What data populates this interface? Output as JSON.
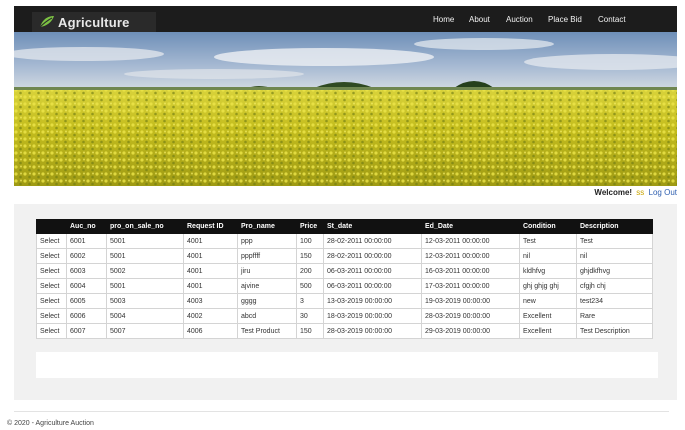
{
  "brand": {
    "name": "Agriculture"
  },
  "nav": {
    "items": [
      "Home",
      "About",
      "Auction",
      "Place Bid",
      "Contact"
    ]
  },
  "user": {
    "welcome": "Welcome!",
    "name": "ss",
    "logout": "Log Out"
  },
  "table": {
    "headers": [
      "",
      "Auc_no",
      "pro_on_sale_no",
      "Request ID",
      "Pro_name",
      "Price",
      "St_date",
      "Ed_Date",
      "Condition",
      "Description"
    ],
    "select_label": "Select",
    "rows": [
      [
        "6001",
        "5001",
        "4001",
        "ppp",
        "100",
        "28-02-2011 00:00:00",
        "12-03-2011 00:00:00",
        "Test",
        "Test"
      ],
      [
        "6002",
        "5001",
        "4001",
        "pppffff",
        "150",
        "28-02-2011 00:00:00",
        "12-03-2011 00:00:00",
        "nil",
        "nil"
      ],
      [
        "6003",
        "5002",
        "4001",
        "jiru",
        "200",
        "06-03-2011 00:00:00",
        "16-03-2011 00:00:00",
        "kldhfvg",
        "ghjdkfhvg"
      ],
      [
        "6004",
        "5001",
        "4001",
        "ajvine",
        "500",
        "06-03-2011 00:00:00",
        "17-03-2011 00:00:00",
        "ghj ghjg ghj",
        "cfgjh chj"
      ],
      [
        "6005",
        "5003",
        "4003",
        "gggg",
        "3",
        "13-03-2019 00:00:00",
        "19-03-2019 00:00:00",
        "new",
        "test234"
      ],
      [
        "6006",
        "5004",
        "4002",
        "abcd",
        "30",
        "18-03-2019 00:00:00",
        "28-03-2019 00:00:00",
        "Excellent",
        "Rare"
      ],
      [
        "6007",
        "5007",
        "4006",
        "Test Product",
        "150",
        "28-03-2019 00:00:00",
        "29-03-2019 00:00:00",
        "Excellent",
        "Test Description"
      ]
    ]
  },
  "footer": {
    "text": "© 2020 - Agriculture Auction"
  },
  "colors": {
    "navbar": "#1c1c1c",
    "table_header": "#111111",
    "panel": "#f1f1f1",
    "username": "#c9a400",
    "link": "#3060b0"
  }
}
